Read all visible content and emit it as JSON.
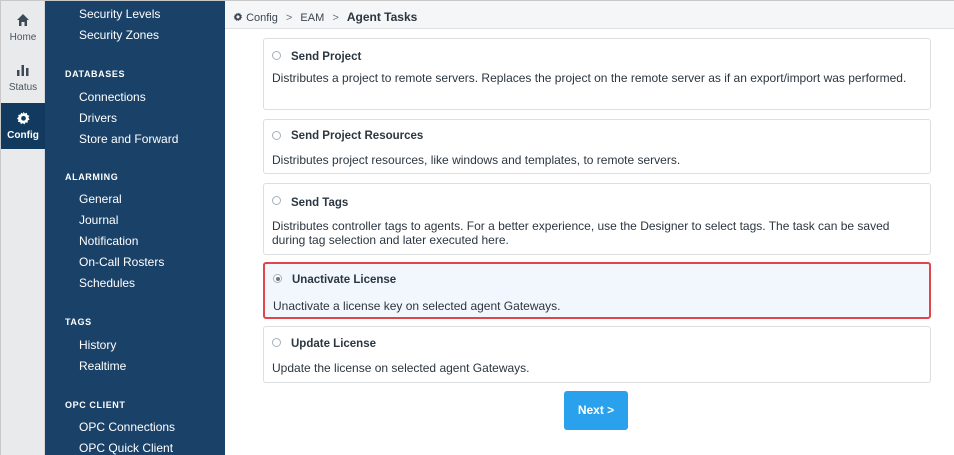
{
  "rail": {
    "home_label": "Home",
    "status_label": "Status",
    "config_label": "Config"
  },
  "sidebar": {
    "security_links": [
      "Security Levels",
      "Security Zones"
    ],
    "databases_heading": "DATABASES",
    "databases_links": [
      "Connections",
      "Drivers",
      "Store and Forward"
    ],
    "alarming_heading": "ALARMING",
    "alarming_links": [
      "General",
      "Journal",
      "Notification",
      "On-Call Rosters",
      "Schedules"
    ],
    "tags_heading": "TAGS",
    "tags_links": [
      "History",
      "Realtime"
    ],
    "opc_heading": "OPC CLIENT",
    "opc_links": [
      "OPC Connections",
      "OPC Quick Client"
    ]
  },
  "breadcrumb": {
    "icon": "gear-icon",
    "config": "Config",
    "eam": "EAM",
    "current": "Agent Tasks",
    "separator": ">"
  },
  "tasks": [
    {
      "title": "Send Project",
      "desc": "Distributes a project to remote servers. Replaces the project on the remote server as if an export/import was performed.",
      "selected": false
    },
    {
      "title": "Send Project Resources",
      "desc": "Distributes project resources, like windows and templates, to remote servers.",
      "selected": false
    },
    {
      "title": "Send Tags",
      "desc": "Distributes controller tags to agents. For a better experience, use the Designer to select tags. The task can be saved during tag selection and later executed here.",
      "selected": false
    },
    {
      "title": "Unactivate License",
      "desc": "Unactivate a license key on selected agent Gateways.",
      "selected": true
    },
    {
      "title": "Update License",
      "desc": "Update the license on selected agent Gateways.",
      "selected": false
    }
  ],
  "next_label": "Next >",
  "colors": {
    "sidebar_bg": "#1a4168",
    "button_bg": "#2aa1ec",
    "highlight_border": "#e0454b"
  }
}
